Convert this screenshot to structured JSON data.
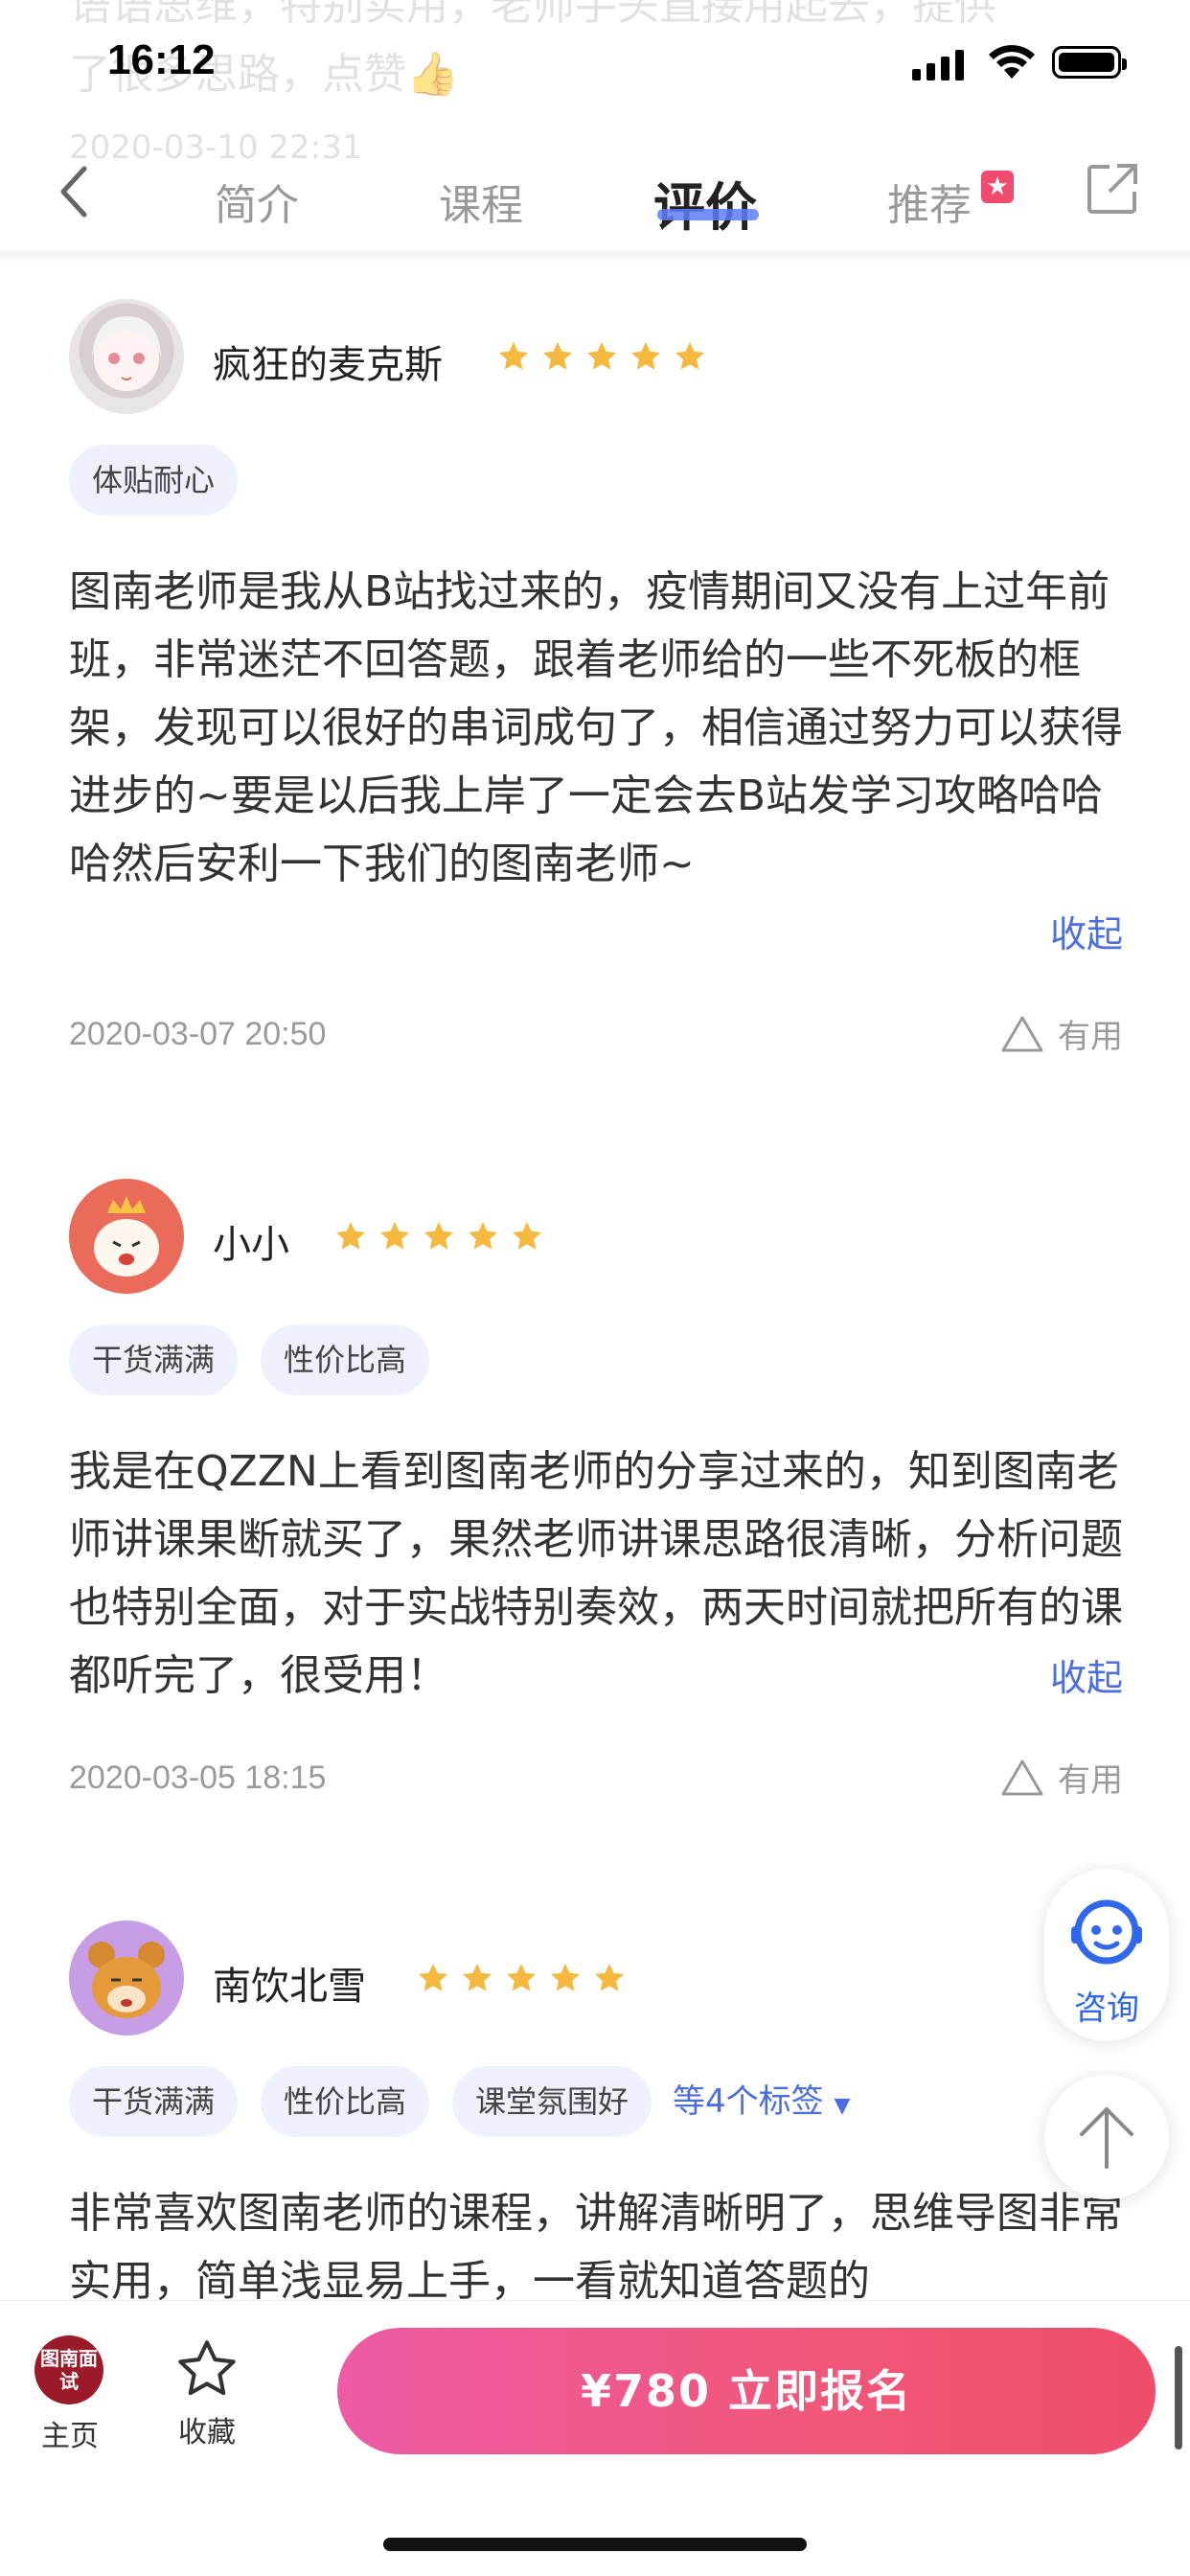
{
  "status_bar": {
    "time": "16:12"
  },
  "background_bleed": {
    "line1": "语语思维，特别实用，老师手头直接用起去，提供",
    "line2": "了很多思路，点赞👍",
    "line3": "2020-03-10 22:31"
  },
  "nav": {
    "tabs": [
      {
        "label": "简介"
      },
      {
        "label": "课程"
      },
      {
        "label": "评价"
      },
      {
        "label": "推荐"
      }
    ],
    "active_tab": "评价"
  },
  "reviews": [
    {
      "username": "疯狂的麦克斯",
      "rating": 5,
      "tags": [
        "体贴耐心"
      ],
      "body": "图南老师是我从B站找过来的，疫情期间又没有上过年前班，非常迷茫不回答题，跟着老师给的一些不死板的框架，发现可以很好的串词成句了，相信通过努力可以获得进步的~要是以后我上岸了一定会去B站发学习攻略哈哈哈然后安利一下我们的图南老师~",
      "collapse_label": "收起",
      "date": "2020-03-07 20:50",
      "useful_label": "有用"
    },
    {
      "username": "小小",
      "rating": 5,
      "tags": [
        "干货满满",
        "性价比高"
      ],
      "body": "我是在QZZN上看到图南老师的分享过来的，知到图南老师讲课果断就买了，果然老师讲课思路很清晰，分析问题也特别全面，对于实战特别奏效，两天时间就把所有的课都听完了，很受用！",
      "collapse_label": "收起",
      "date": "2020-03-05 18:15",
      "useful_label": "有用"
    },
    {
      "username": "南饮北雪",
      "rating": 5,
      "tags": [
        "干货满满",
        "性价比高",
        "课堂氛围好"
      ],
      "more_tags_label": "等4个标签",
      "body": "非常喜欢图南老师的课程，讲解清晰明了，思维导图非常实用，简单浅显易上手，一看就知道答题的"
    }
  ],
  "floating": {
    "consult_label": "咨询"
  },
  "bottom_bar": {
    "home_logo": "图南面试",
    "home_label": "主页",
    "favorite_label": "收藏",
    "cta_label": "¥780  立即报名"
  },
  "colors": {
    "accent_blue": "#4a6ee0",
    "star": "#f5b93f",
    "cta_gradient_start": "#ee5aa4",
    "cta_gradient_end": "#ef4d6a",
    "tag_bg": "#eef0fb"
  }
}
